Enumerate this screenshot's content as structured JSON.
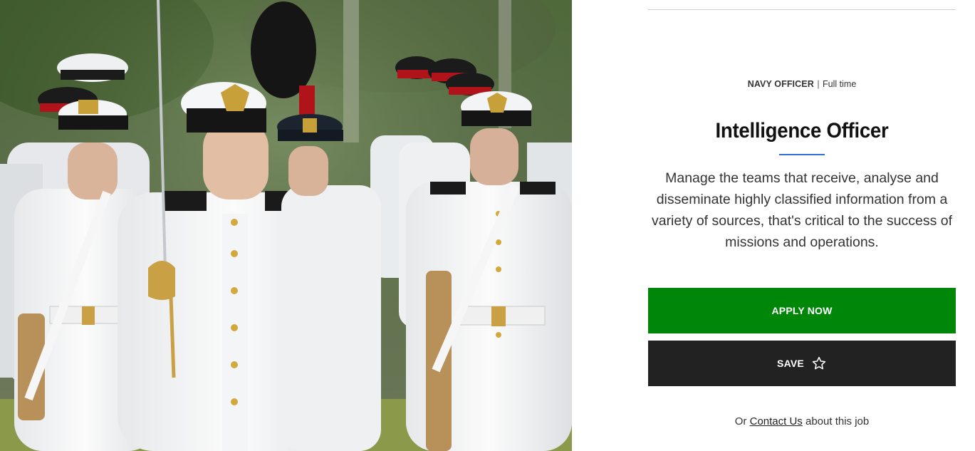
{
  "hero": {
    "image_icon": "photo-naval-officers-parade"
  },
  "job": {
    "role": "NAVY OFFICER",
    "separator": "|",
    "employment_type": "Full time",
    "title": "Intelligence Officer",
    "description": "Manage the teams that receive, analyse and disseminate highly classified information from a variety of sources, that's critical to the success of missions and operations."
  },
  "actions": {
    "apply_label": "APPLY NOW",
    "save_label": "SAVE",
    "save_icon": "star-outline-icon",
    "contact_prefix": "Or",
    "contact_link": "Contact Us",
    "contact_suffix": "about this job"
  },
  "colors": {
    "apply_bg": "#00870a",
    "save_bg": "#222222",
    "title_underline": "#2f6fd6"
  }
}
